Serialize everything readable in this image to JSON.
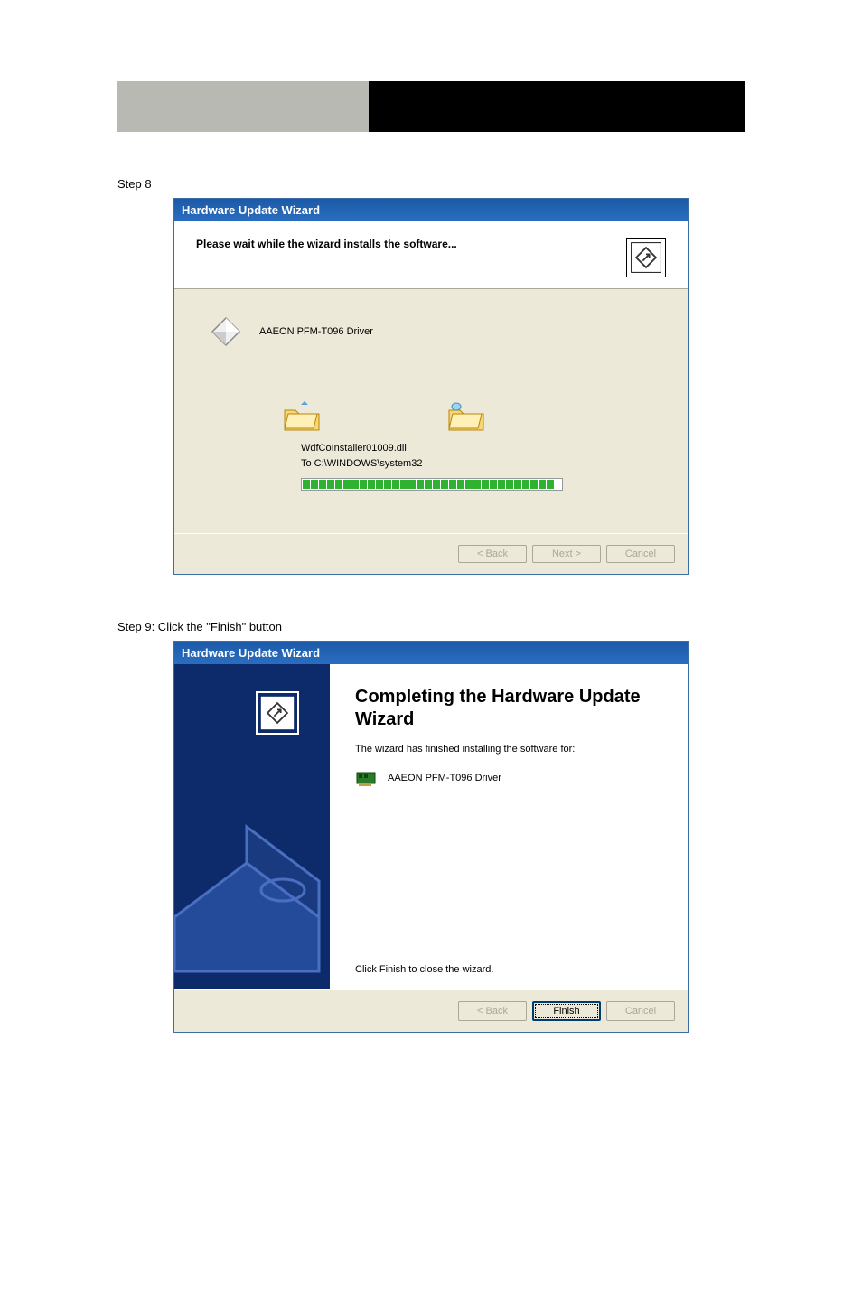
{
  "header": {
    "light": "",
    "dark": ""
  },
  "step8": "Step 8",
  "step9_prefix": "Step 9: Click the",
  "step9_finish": "\"Finish\"",
  "step9_suffix": "button",
  "wizard1": {
    "title": "Hardware Update Wizard",
    "header": "Please wait while the wizard installs the software...",
    "driver": "AAEON PFM-T096 Driver",
    "file": "WdfCoInstaller01009.dll",
    "dest": "To C:\\WINDOWS\\system32",
    "back": "< Back",
    "next": "Next >",
    "cancel": "Cancel"
  },
  "wizard2": {
    "title": "Hardware Update Wizard",
    "heading": "Completing the Hardware Update Wizard",
    "sub": "The wizard has finished installing the software for:",
    "driver": "AAEON PFM-T096 Driver",
    "closeText": "Click Finish to close the wizard.",
    "back": "< Back",
    "finish": "Finish",
    "cancel": "Cancel"
  }
}
